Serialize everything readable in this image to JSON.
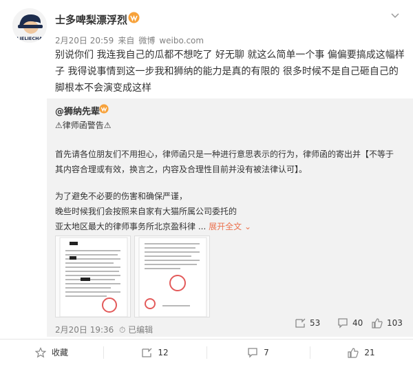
{
  "post": {
    "username": "士多啤梨漂浮烈",
    "avatar_text": "LIELIECHA",
    "time": "2月20日 20:59",
    "source_prefix": "来自",
    "source": "微博",
    "source_domain": "weibo.com",
    "text": "别说你们 我连我自己的瓜都不想吃了 好无聊 就这么简单一个事 偏偏要搞成这幅样子 我得说事情到这一步我和狮纳的能力是真的有限的 很多时候不是自己砸自己的脚根本不会演变成这样"
  },
  "repost": {
    "username": "@狮纳先辈",
    "lines": [
      "⚠律师函警告⚠",
      "首先请各位朋友们不用担心，律师函只是一种进行意思表示的行为，律师函的寄出并【不等于",
      "其内容合理或有效，换言之，内容及合理性目前并没有被法律认可】。",
      "为了避免不必要的伤害和确保严谨，",
      "晚些时候我们会按照来自家有大猫所属公司委托的",
      "亚太地区最大的律师事务所北京盈科律 ..."
    ],
    "expand_label": "展开全文",
    "time": "2月20日 19:36",
    "edited_label": "已编辑",
    "reposts": "53",
    "comments": "40",
    "likes": "103"
  },
  "bottom_bar": {
    "favorite_label": "收藏",
    "repost_count": "12",
    "comment_count": "7",
    "like_count": "21"
  },
  "colors": {
    "accent": "#eb7350",
    "link": "#eb7350",
    "meta": "#808080",
    "card_bg": "#f2f2f2"
  }
}
